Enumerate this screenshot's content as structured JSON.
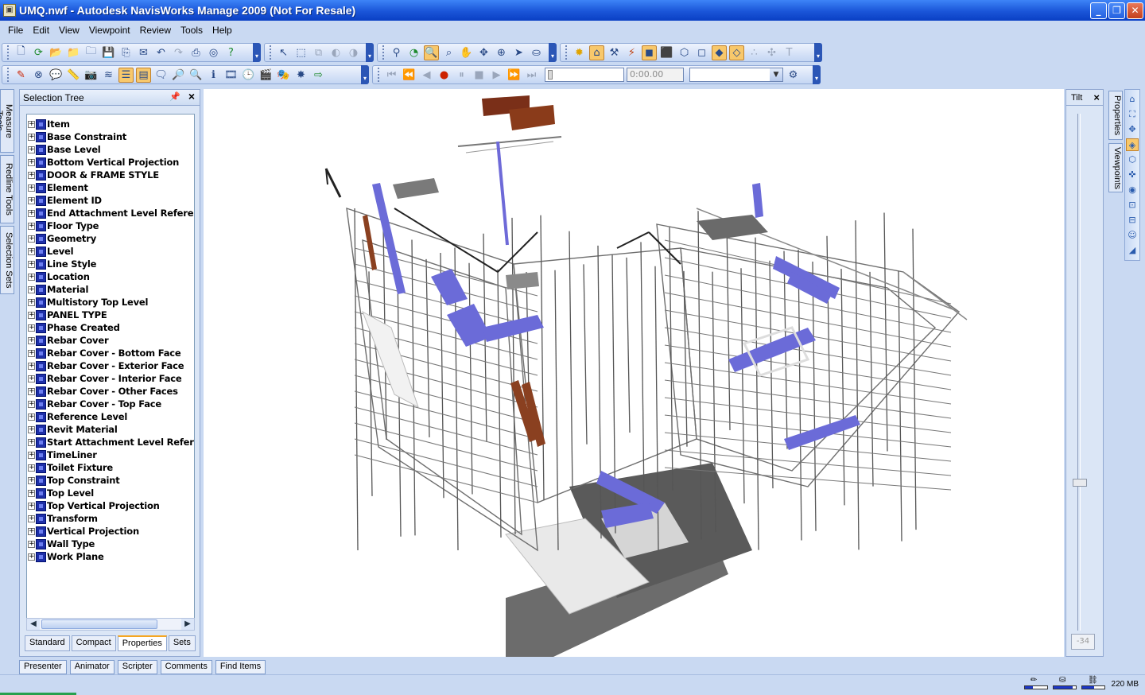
{
  "window": {
    "title": "UMQ.nwf - Autodesk NavisWorks Manage 2009 (Not For Resale)",
    "icon": "navisworks-app-icon",
    "buttons": [
      "minimize",
      "maximize",
      "close"
    ]
  },
  "menu": [
    "File",
    "Edit",
    "View",
    "Viewpoint",
    "Review",
    "Tools",
    "Help"
  ],
  "left_dock_tabs": [
    "Measure Tools",
    "Redline Tools",
    "Selection Sets"
  ],
  "selection_tree": {
    "title": "Selection Tree",
    "items": [
      "Item",
      "Base Constraint",
      "Base Level",
      "Bottom Vertical Projection",
      "DOOR & FRAME STYLE",
      "Element",
      "Element ID",
      "End Attachment Level Referen",
      "Floor Type",
      "Geometry",
      "Level",
      "Line Style",
      "Location",
      "Material",
      "Multistory Top Level",
      "PANEL TYPE",
      "Phase Created",
      "Rebar Cover",
      "Rebar Cover - Bottom Face",
      "Rebar Cover - Exterior Face",
      "Rebar Cover - Interior Face",
      "Rebar Cover - Other Faces",
      "Rebar Cover - Top Face",
      "Reference Level",
      "Revit Material",
      "Start Attachment Level Refere",
      "TimeLiner",
      "Toilet Fixture",
      "Top Constraint",
      "Top Level",
      "Top Vertical Projection",
      "Transform",
      "Vertical Projection",
      "Wall Type",
      "Work Plane"
    ],
    "tabs": [
      "Standard",
      "Compact",
      "Properties",
      "Sets"
    ],
    "active_tab": "Properties"
  },
  "animation": {
    "time": "0:00.00"
  },
  "tilt": {
    "title": "Tilt",
    "value": "-34",
    "level": 0.71
  },
  "right_dock_tabs": [
    "Properties",
    "Viewpoints"
  ],
  "bottom_tabs": [
    "Presenter",
    "Animator",
    "Scripter",
    "Comments",
    "Find Items"
  ],
  "status": {
    "memory": "220 MB",
    "bars": [
      0.35,
      0.85,
      0.55
    ]
  }
}
